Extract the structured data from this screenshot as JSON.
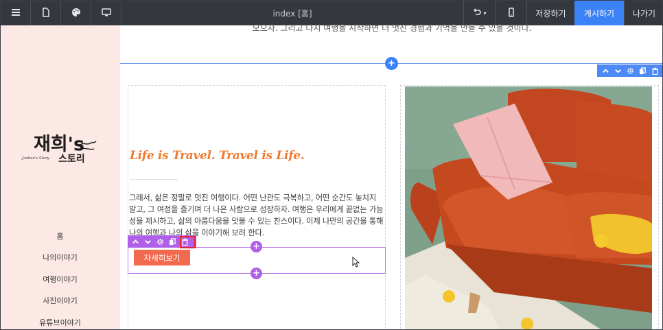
{
  "toolbar": {
    "menu_icon": "hamburger-icon",
    "page_icon": "document-icon",
    "theme_icon": "palette-icon",
    "desktop_icon": "monitor-icon",
    "title": "index [홈]",
    "undo_icon": "undo-icon",
    "mobile_icon": "mobile-icon",
    "save_label": "저장하기",
    "publish_label": "게시하기",
    "exit_label": "나가기",
    "publish_color": "#3b82f6"
  },
  "sidebar": {
    "logo_main": "재희's",
    "logo_sub": "스토리",
    "logo_small": "Jaehee's Story",
    "items": [
      {
        "label": "홈"
      },
      {
        "label": "나의이야기"
      },
      {
        "label": "여행이야기"
      },
      {
        "label": "사진이야기"
      },
      {
        "label": "유튜브이야기"
      }
    ],
    "background": "#fce9e6"
  },
  "main": {
    "top_text": "모으자. 그리고 다시 여행을 시작하면 더 멋진 경험과 기억을 만들 수 있을 것이다.",
    "slogan": "Life is Travel. Travel is Life.",
    "body_text": "그래서, 삶은 정말로 멋진 여행이다. 어떤 난관도 극복하고, 어떤 순간도 놓치지 말고, 그 여정을 즐기며 더 나은 사람으로 성장하자. 여행은 우리에게 끝없는 가능성을 제시하고, 삶의 아름다움을 맛볼 수 있는 찬스이다. 이제 나만의 공간을 통해 나의 여행과 나의 삶을 이야기해 보려 한다.",
    "button_label": "자세히보기",
    "button_color": "#f16a4f",
    "photo_alt": "orange sofa with pink pillow"
  },
  "section_tools": {
    "icons": [
      "chevron-up-icon",
      "chevron-down-icon",
      "gear-icon",
      "copy-icon",
      "trash-icon"
    ],
    "color": "#4d8af6"
  },
  "element_tools": {
    "icons": [
      "chevron-up-icon",
      "chevron-down-icon",
      "gear-icon",
      "copy-icon",
      "trash-icon"
    ],
    "color": "#b05fe8",
    "highlight_color": "#e8262d"
  }
}
